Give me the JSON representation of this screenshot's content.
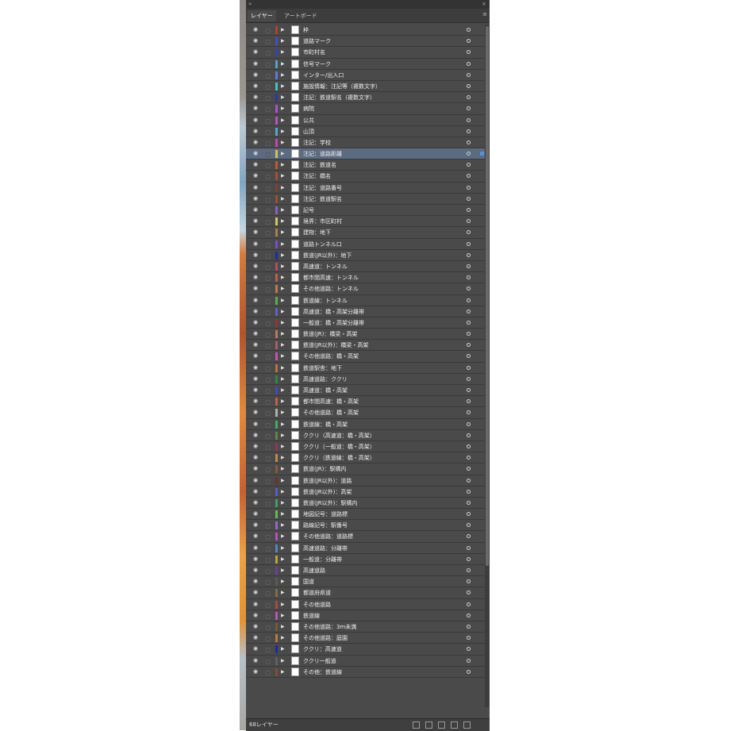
{
  "panel": {
    "tabs": [
      "レイヤー",
      "アートボード"
    ],
    "footer_count": "68レイヤー"
  },
  "layers": [
    {
      "name": "枠",
      "color": "#c0392b"
    },
    {
      "name": "道路マーク",
      "color": "#3a52c9"
    },
    {
      "name": "市町村名",
      "color": "#2c46c0"
    },
    {
      "name": "信号マーク",
      "color": "#4fa3d1"
    },
    {
      "name": "インター/出入口",
      "color": "#5c7adf"
    },
    {
      "name": "施設情報：注記等（複数文字）",
      "color": "#3cc3c9"
    },
    {
      "name": "注記：鉄道駅名（複数文字）",
      "color": "#2238b4"
    },
    {
      "name": "病院",
      "color": "#b44bd6"
    },
    {
      "name": "公共",
      "color": "#c24ad8"
    },
    {
      "name": "山頂",
      "color": "#4aaad8"
    },
    {
      "name": "注記：学校",
      "color": "#d23cc0"
    },
    {
      "name": "注記：道路距離",
      "color": "#d6c24a",
      "selected": true
    },
    {
      "name": "注記：鉄道名",
      "color": "#c05a2c"
    },
    {
      "name": "注記：橋名",
      "color": "#b44a2c"
    },
    {
      "name": "注記：道路番号",
      "color": "#8c3a2c"
    },
    {
      "name": "注記：鉄道駅名",
      "color": "#a05028"
    },
    {
      "name": "記号",
      "color": "#8b5cd6"
    },
    {
      "name": "境界：市区町村",
      "color": "#c9d24a"
    },
    {
      "name": "建物：地下",
      "color": "#b08040"
    },
    {
      "name": "道路トンネル口",
      "color": "#7a4ad2"
    },
    {
      "name": "鉄道(JR以外)：地下",
      "color": "#1a2bb8"
    },
    {
      "name": "高速道：トンネル",
      "color": "#c04a5a"
    },
    {
      "name": "都市間高速：トンネル",
      "color": "#c06040"
    },
    {
      "name": "その他道路：トンネル",
      "color": "#c8783a"
    },
    {
      "name": "鉄道線：トンネル",
      "color": "#5ab04a"
    },
    {
      "name": "高速道：橋・高架分離帯",
      "color": "#6060d0"
    },
    {
      "name": "一般道：橋・高架分離帯",
      "color": "#a03030"
    },
    {
      "name": "鉄道(JR)：橋梁・高架",
      "color": "#c07a50"
    },
    {
      "name": "鉄道(JR以外)：橋梁・高架",
      "color": "#b05a70"
    },
    {
      "name": "その他道路：橋・高架",
      "color": "#d04ac0"
    },
    {
      "name": "鉄道駅舎：地下",
      "color": "#c07030"
    },
    {
      "name": "高速道路：ククリ",
      "color": "#2c8a40"
    },
    {
      "name": "高速道：橋・高架",
      "color": "#3c4ad0"
    },
    {
      "name": "都市間高速：橋・高架",
      "color": "#c06048"
    },
    {
      "name": "その他道路：橋・高架",
      "color": "#b0b0b0"
    },
    {
      "name": "鉄道線：橋・高架",
      "color": "#3ab060"
    },
    {
      "name": "ククリ（高速道：橋・高架）",
      "color": "#5a8a40"
    },
    {
      "name": "ククリ（一般道：橋・高架）",
      "color": "#a03050"
    },
    {
      "name": "ククリ（鉄道線：橋・高架）",
      "color": "#c08a40"
    },
    {
      "name": "鉄道(JR)：駅構内",
      "color": "#8a5a30"
    },
    {
      "name": "鉄道(JR以外)：道路",
      "color": "#703030"
    },
    {
      "name": "鉄道(JR以外)：高架",
      "color": "#5a5ad0"
    },
    {
      "name": "鉄道(JR以外)：駅構内",
      "color": "#40a060"
    },
    {
      "name": "地図記号：道路標",
      "color": "#5ac050"
    },
    {
      "name": "路線記号：駅番号",
      "color": "#8a6ad0"
    },
    {
      "name": "その他道路：道路標",
      "color": "#c04ac0"
    },
    {
      "name": "高速道路：分離帯",
      "color": "#4a8ac0"
    },
    {
      "name": "一般道：分離帯",
      "color": "#c0a040"
    },
    {
      "name": "高速道路",
      "color": "#6a40a0"
    },
    {
      "name": "国道",
      "color": "#5a5a5a"
    },
    {
      "name": "都道府県道",
      "color": "#8a6a40"
    },
    {
      "name": "その他道路",
      "color": "#b04a30"
    },
    {
      "name": "鉄道線",
      "color": "#c050c0"
    },
    {
      "name": "その他道路：3m未満",
      "color": "#7a5a30"
    },
    {
      "name": "その他道路：庭園",
      "color": "#c07830"
    },
    {
      "name": "ククリ：高速道",
      "color": "#1a2ab0"
    },
    {
      "name": "ククリ一般道",
      "color": "#606060"
    },
    {
      "name": "その他：鉄道線",
      "color": "#8a4a30"
    }
  ]
}
